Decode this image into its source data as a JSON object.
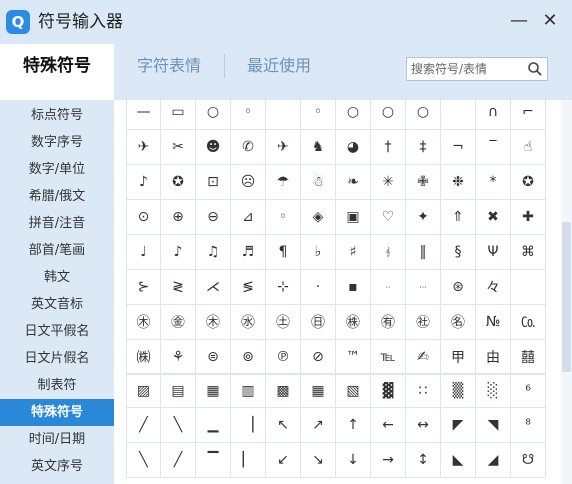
{
  "app": {
    "title": "符号输入器"
  },
  "window": {
    "minimize": "—",
    "close": "✕"
  },
  "tabs": [
    {
      "label": "特殊符号"
    },
    {
      "label": "字符表情"
    },
    {
      "label": "最近使用"
    }
  ],
  "search": {
    "placeholder": "搜索符号/表情"
  },
  "sidebar": {
    "items": [
      {
        "label": "标点符号"
      },
      {
        "label": "数字序号"
      },
      {
        "label": "数字/单位"
      },
      {
        "label": "希腊/俄文"
      },
      {
        "label": "拼音/注音"
      },
      {
        "label": "部首/笔画"
      },
      {
        "label": "韩文"
      },
      {
        "label": "英文音标"
      },
      {
        "label": "日文平假名"
      },
      {
        "label": "日文片假名"
      },
      {
        "label": "制表符"
      },
      {
        "label": "特殊符号"
      },
      {
        "label": "时间/日期"
      },
      {
        "label": "英文序号"
      }
    ],
    "active_index": 11
  },
  "symbols_block1": [
    "—",
    "▭",
    "○",
    "◦",
    "",
    "◦",
    "○",
    "○",
    "○",
    "",
    "∩",
    "⌐",
    "✈",
    "✂",
    "☻",
    "✆",
    "✈",
    "♞",
    "◕",
    "†",
    "‡",
    "¬",
    "‾",
    "☝",
    "♪",
    "✪",
    "⊡",
    "☹",
    "☂",
    "☃",
    "❧",
    "✳",
    "✙",
    "❉",
    "*",
    "✪",
    "⊙",
    "⊕",
    "⊖",
    "⊿",
    "◦",
    "◈",
    "▣",
    "♡",
    "✦",
    "⇑",
    "✖",
    "✚",
    "♩",
    "♪",
    "♫",
    "♬",
    "¶",
    "♭",
    "♯",
    "𝄞",
    "‖",
    "§",
    "Ψ",
    "⌘",
    "⊱",
    "≷",
    "⋌",
    "≶",
    "⊹",
    "·",
    "▪",
    "··",
    "···",
    "⊛",
    "々",
    "",
    "㊍",
    "㊎",
    "㊍",
    "㊌",
    "㊏",
    "㊐",
    "㊑",
    "㊒",
    "㊓",
    "㊔",
    "№",
    "㏇",
    "㈱",
    "⚘",
    "⊜",
    "⊚",
    "℗",
    "⊘",
    "™",
    "℡",
    "✍",
    "甲",
    "由",
    "囍"
  ],
  "symbols_block2": [
    "▨",
    "▤",
    "▦",
    "▥",
    "▩",
    "▦",
    "▧",
    "▓",
    "∷",
    "▒",
    "░",
    "⁶",
    "╱",
    "╲",
    "▁",
    "▕",
    "↖",
    "↗",
    "↑",
    "←",
    "↔",
    "◤",
    "◥",
    "⁸",
    "╲",
    "╱",
    "▔",
    "▏",
    "↙",
    "↘",
    "↓",
    "→",
    "↕",
    "◣",
    "◢",
    "☋"
  ]
}
